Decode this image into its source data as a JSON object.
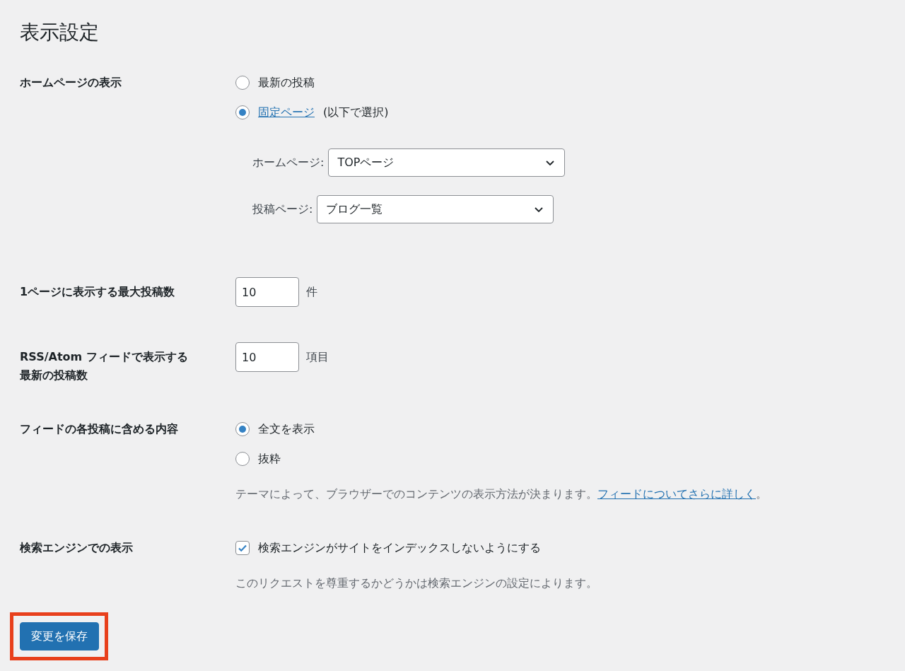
{
  "page_title": "表示設定",
  "settings": [
    {
      "kind": "radio_group",
      "label_lines": [
        "ホームページの表示"
      ],
      "options": [
        {
          "label": "最新の投稿",
          "selected": false
        },
        {
          "link": "固定ページ",
          "label": "(以下で選択)",
          "selected": true
        }
      ],
      "selects": [
        {
          "label": "ホームページ:",
          "value": "TOPページ"
        },
        {
          "label": "投稿ページ:",
          "value": "ブログ一覧"
        }
      ]
    },
    {
      "kind": "number",
      "label_lines": [
        "1ページに表示する最大投稿数"
      ],
      "value": "10",
      "unit": "件"
    },
    {
      "kind": "number",
      "label_lines": [
        "RSS/Atom フィードで表示する",
        "最新の投稿数"
      ],
      "value": "10",
      "unit": "項目"
    },
    {
      "kind": "radio_group",
      "label_lines": [
        "フィードの各投稿に含める内容"
      ],
      "options": [
        {
          "label": "全文を表示",
          "selected": true
        },
        {
          "label": "抜粋",
          "selected": false
        }
      ],
      "note": {
        "text": "テーマによって、ブラウザーでのコンテンツの表示方法が決まります。",
        "link": "フィードについてさらに詳しく",
        "end": "。"
      }
    },
    {
      "kind": "checkbox",
      "label_lines": [
        "検索エンジンでの表示"
      ],
      "option": {
        "label": "検索エンジンがサイトをインデックスしないようにする",
        "checked": true
      },
      "note": {
        "text": "このリクエストを尊重するかどうかは検索エンジンの設定によります。"
      }
    }
  ],
  "save_button": {
    "label": "変更を保存",
    "highlighted": true
  }
}
